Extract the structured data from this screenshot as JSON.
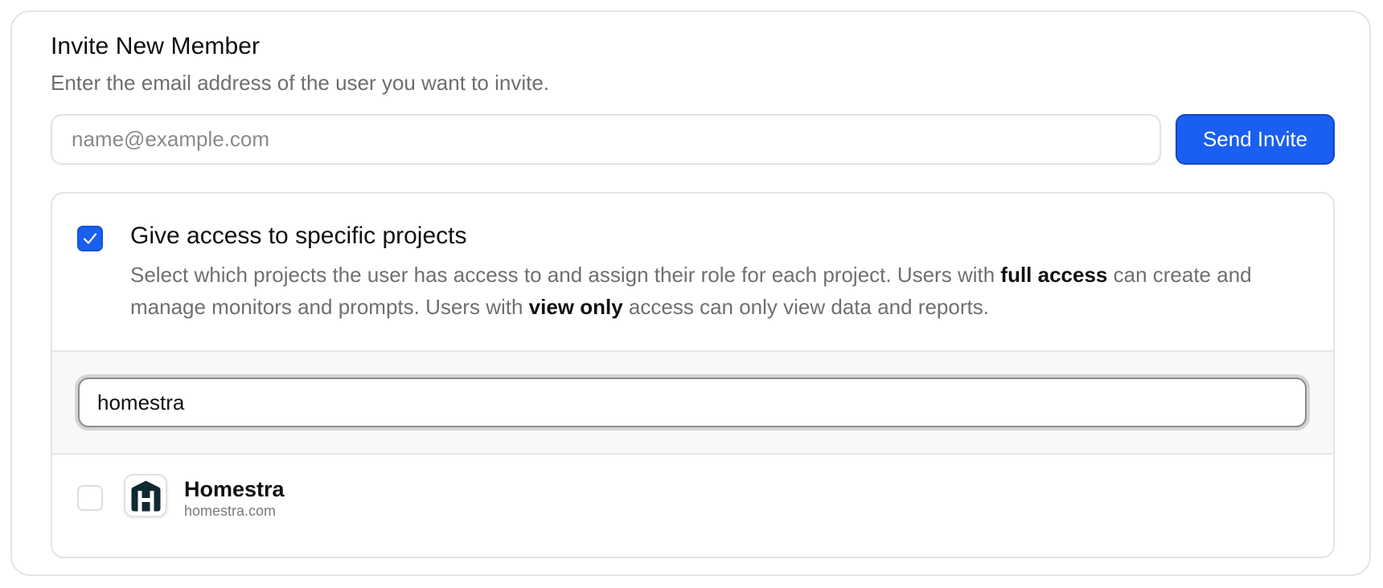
{
  "invite": {
    "title": "Invite New Member",
    "subtitle": "Enter the email address of the user you want to invite.",
    "email_placeholder": "name@example.com",
    "email_value": "",
    "send_label": "Send Invite",
    "accent_color": "#1a5ff0"
  },
  "access": {
    "checkbox_checked": true,
    "title": "Give access to specific projects",
    "desc_part1": "Select which projects the user has access to and assign their role for each project. Users with ",
    "desc_bold1": "full access",
    "desc_part2": " can create and manage monitors and prompts. Users with ",
    "desc_bold2": "view only",
    "desc_part3": " access can only view data and reports."
  },
  "search": {
    "value": "homestra"
  },
  "projects": [
    {
      "name": "Homestra",
      "domain": "homestra.com",
      "selected": false,
      "logo_icon": "house-h-logo-icon"
    }
  ]
}
